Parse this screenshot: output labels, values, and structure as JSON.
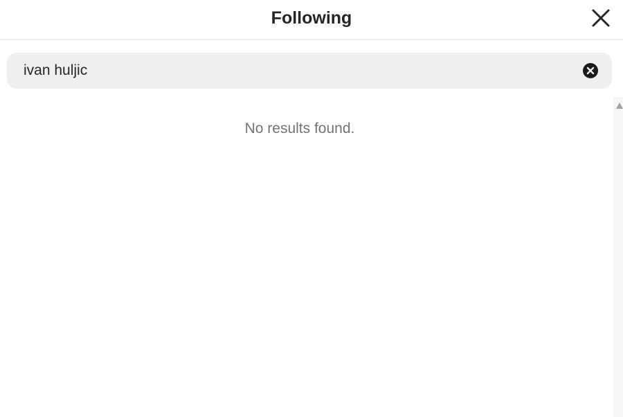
{
  "header": {
    "title": "Following",
    "close_icon": "close-icon"
  },
  "search": {
    "value": "ivan huljic",
    "clear_icon": "clear-circle-icon"
  },
  "results": {
    "empty_message": "No results found."
  },
  "colors": {
    "background": "#ffffff",
    "search_bg": "#efefef",
    "title_text": "#262626",
    "muted_text": "#737373"
  }
}
